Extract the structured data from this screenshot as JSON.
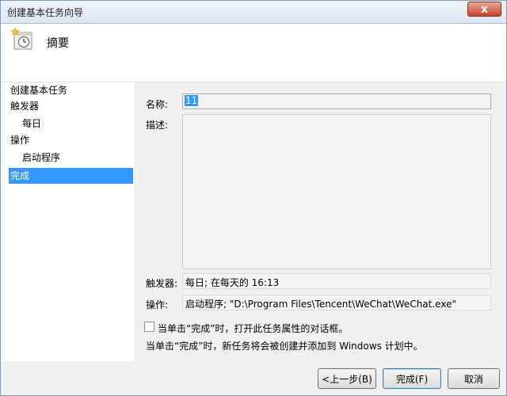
{
  "window": {
    "title": "创建基本任务向导",
    "close_label": "x"
  },
  "header": {
    "title": "摘要",
    "icon": "task-clock-icon"
  },
  "sidebar": {
    "steps": [
      {
        "label": "创建基本任务",
        "level": 0,
        "active": false
      },
      {
        "label": "触发器",
        "level": 0,
        "active": false
      },
      {
        "label": "每日",
        "level": 1,
        "active": false
      },
      {
        "label": "操作",
        "level": 0,
        "active": false
      },
      {
        "label": "启动程序",
        "level": 1,
        "active": false
      },
      {
        "label": "完成",
        "level": 0,
        "active": true
      }
    ]
  },
  "form": {
    "name_label": "名称:",
    "name_value": "11",
    "description_label": "描述:",
    "description_value": "",
    "trigger_label": "触发器:",
    "trigger_value": "每日; 在每天的 16:13",
    "action_label": "操作:",
    "action_value": "启动程序; \"D:\\Program Files\\Tencent\\WeChat\\WeChat.exe\"",
    "checkbox_label": "当单击“完成”时，打开此任务属性的对话框。",
    "checkbox_checked": false,
    "note": "当单击“完成”时，新任务将会被创建并添加到 Windows 计划中。"
  },
  "buttons": {
    "back": "<上一步(B)",
    "finish": "完成(F)",
    "cancel": "取消"
  },
  "colors": {
    "selection": "#3399ff",
    "close_button": "#c7422b"
  }
}
